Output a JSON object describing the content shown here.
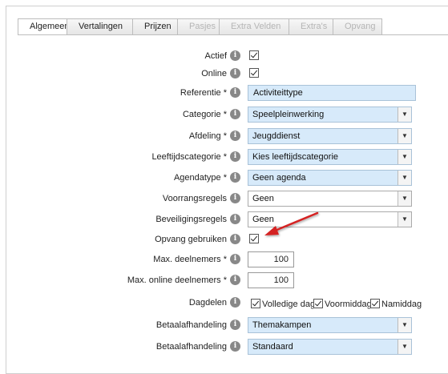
{
  "tabs": [
    {
      "label": "Algemeen",
      "state": "active"
    },
    {
      "label": "Vertalingen",
      "state": "normal"
    },
    {
      "label": "Prijzen",
      "state": "normal"
    },
    {
      "label": "Pasjes",
      "state": "disabled"
    },
    {
      "label": "Extra Velden",
      "state": "disabled"
    },
    {
      "label": "Extra's",
      "state": "disabled"
    },
    {
      "label": "Opvang",
      "state": "disabled"
    }
  ],
  "info_glyph": "i",
  "fields": {
    "actief": {
      "label": "Actief",
      "checked": true
    },
    "online": {
      "label": "Online",
      "checked": true
    },
    "referentie": {
      "label": "Referentie *",
      "value": "Activiteittype"
    },
    "categorie": {
      "label": "Categorie *",
      "value": "Speelpleinwerking"
    },
    "afdeling": {
      "label": "Afdeling *",
      "value": "Jeugddienst"
    },
    "leeftijdscategorie": {
      "label": "Leeftijdscategorie *",
      "value": "Kies leeftijdscategorie"
    },
    "agendatype": {
      "label": "Agendatype *",
      "value": "Geen agenda"
    },
    "voorrangsregels": {
      "label": "Voorrangsregels",
      "value": "Geen"
    },
    "beveiligingsregels": {
      "label": "Beveiligingsregels",
      "value": "Geen"
    },
    "opvang": {
      "label": "Opvang gebruiken",
      "checked": true
    },
    "max_deelnemers": {
      "label": "Max. deelnemers *",
      "value": "100"
    },
    "max_online": {
      "label": "Max. online deelnemers *",
      "value": "100"
    },
    "dagdelen": {
      "label": "Dagdelen",
      "options": [
        "Volledige dag",
        "Voormiddag",
        "Namiddag"
      ]
    },
    "betaal1": {
      "label": "Betaalafhandeling",
      "value": "Themakampen"
    },
    "betaal2": {
      "label": "Betaalafhandeling",
      "value": "Standaard"
    }
  },
  "colors": {
    "highlight_bg": "#d7eafa",
    "arrow": "#d42020"
  }
}
